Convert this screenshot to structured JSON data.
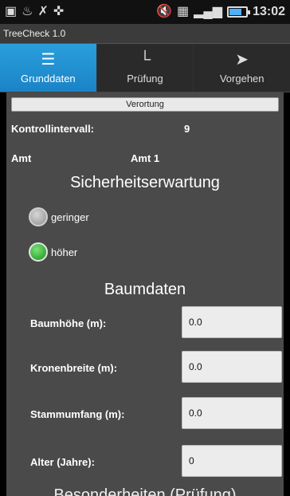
{
  "status_bar": {
    "time": "13:02",
    "icons": [
      "notification-icon",
      "fire-icon",
      "missed-call-icon",
      "usb-icon",
      "mute-icon",
      "sd-card-icon",
      "signal-icon",
      "battery-icon"
    ],
    "battery_level": 0.7
  },
  "app": {
    "title": "TreeCheck 1.0"
  },
  "tabs": [
    {
      "label": "Grunddaten",
      "icon": "list-icon",
      "active": true
    },
    {
      "label": "Prüfung",
      "icon": "ruler-icon",
      "active": false
    },
    {
      "label": "Vorgehen",
      "icon": "tag-icon",
      "active": false
    }
  ],
  "main": {
    "verortung_button": "Verortung",
    "kontrollintervall_label": "Kontrollintervall:",
    "kontrollintervall_value": "9",
    "amt_label": "Amt",
    "amt_value": "Amt 1",
    "sicherheit_heading": "Sicherheitserwartung",
    "sicherheit_options": [
      {
        "label": "geringer",
        "checked": false
      },
      {
        "label": "höher",
        "checked": true
      }
    ],
    "baumdaten_heading": "Baumdaten",
    "fields": [
      {
        "label": "Baumhöhe (m):",
        "value": "0.0"
      },
      {
        "label": "Kronenbreite (m):",
        "value": "0.0"
      },
      {
        "label": "Stammumfang (m):",
        "value": "0.0"
      },
      {
        "label": "Alter (Jahre):",
        "value": "0"
      }
    ],
    "next_heading_partial": "Besonderheiten (Prüfung)"
  }
}
